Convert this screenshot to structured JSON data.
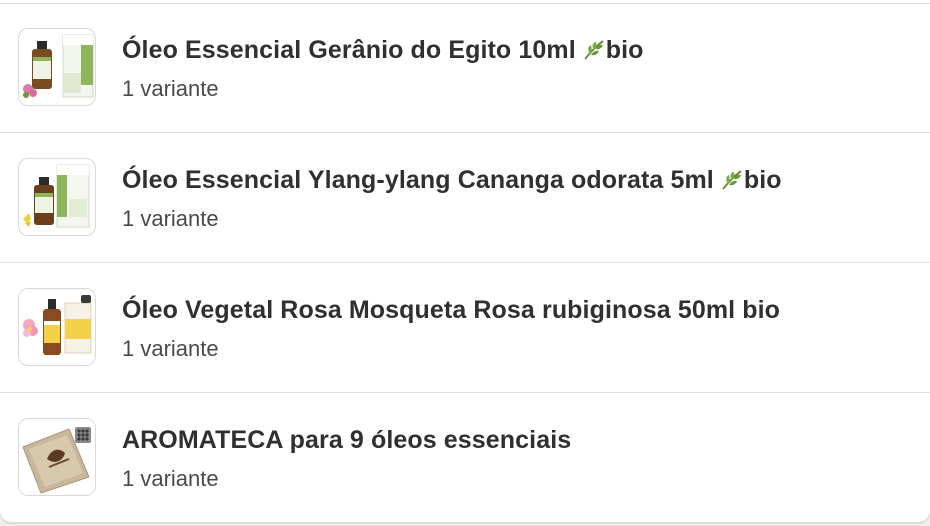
{
  "products": [
    {
      "title": "Óleo Essencial Gerânio do Egito 10ml",
      "badge_icon": "leaf-icon",
      "badge_text": "bio",
      "variants": "1 variante",
      "thumbnail": "geranium-oil-product-image"
    },
    {
      "title": "Óleo Essencial Ylang-ylang Cananga odorata 5ml",
      "badge_icon": "leaf-icon",
      "badge_text": "bio",
      "variants": "1 variante",
      "thumbnail": "ylang-ylang-oil-product-image"
    },
    {
      "title": "Óleo Vegetal Rosa Mosqueta Rosa rubiginosa 50ml bio",
      "variants": "1 variante",
      "thumbnail": "rosehip-oil-product-image"
    },
    {
      "title": "AROMATECA para 9 óleos essenciais",
      "variants": "1 variante",
      "thumbnail": "aromateca-box-product-image"
    }
  ],
  "colors": {
    "title": "#303030",
    "subtitle": "#4a4a4a",
    "divider": "#e3e3e3",
    "leaf": "#6a9a3a"
  }
}
